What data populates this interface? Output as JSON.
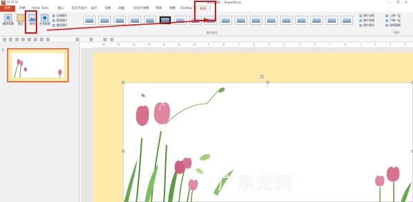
{
  "window": {
    "title": "演示文稿1 - PowerPoint",
    "app_icon": "P",
    "context_tab_group": "图片工具"
  },
  "tabs": [
    {
      "label": "文件"
    },
    {
      "label": "开始"
    },
    {
      "label": "iSlide Tools"
    },
    {
      "label": "插入"
    },
    {
      "label": "幻灯片设计"
    },
    {
      "label": "设计"
    },
    {
      "label": "切换"
    },
    {
      "label": "动画"
    },
    {
      "label": "幻灯片放映"
    },
    {
      "label": "审阅"
    },
    {
      "label": "视图"
    },
    {
      "label": "OneKey 5"
    },
    {
      "label": "格式"
    }
  ],
  "ribbon": {
    "remove_background": "删除背景",
    "corrections": "更正",
    "color": "颜色",
    "artistic_effects": "艺术效果",
    "compress": "压缩图片",
    "change_picture": "更改图片",
    "reset_picture": "重设图片",
    "picture_styles_label": "图片样式",
    "picture_border": "图片边框",
    "picture_effects": "图片效果",
    "picture_layout": "图片版式",
    "bring_forward": "上移一层",
    "send_backward": "下移一层",
    "selection_pane": "选择窗格",
    "arrange_label": "排列"
  },
  "slides_pane": {
    "slide_number": "1"
  },
  "ruler_numbers": [
    "16",
    "15",
    "14",
    "13",
    "12",
    "11",
    "10",
    "9",
    "8",
    "7",
    "6",
    "5",
    "4",
    "3",
    "2",
    "1",
    "0",
    "1",
    "2",
    "3",
    "4"
  ],
  "watermark": "广东龙网",
  "icons": {
    "minimize": "minimize-icon",
    "restore": "restore-icon",
    "close": "close-icon"
  },
  "colors": {
    "accent": "#d24726",
    "highlight": "#e01010",
    "slide_bg": "#fde9a8"
  }
}
